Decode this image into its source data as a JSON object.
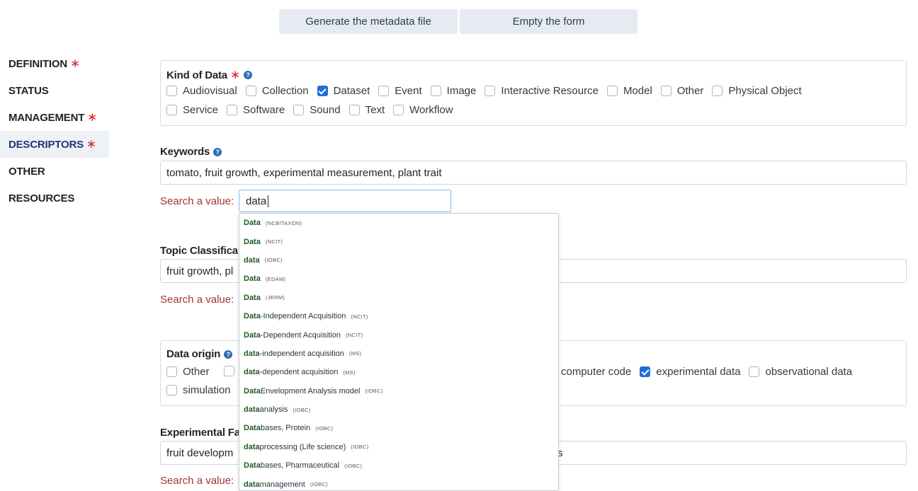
{
  "top_buttons": {
    "generate_label": "Generate the metadata file",
    "empty_label": "Empty the form"
  },
  "nav": {
    "items": [
      {
        "label": "DEFINITION",
        "required": true
      },
      {
        "label": "STATUS",
        "required": false
      },
      {
        "label": "MANAGEMENT",
        "required": true
      },
      {
        "label": "DESCRIPTORS",
        "required": true,
        "active": true
      },
      {
        "label": "OTHER",
        "required": false
      },
      {
        "label": "RESOURCES",
        "required": false
      }
    ],
    "required_mark": "∗"
  },
  "kind_of_data": {
    "label": "Kind of Data",
    "required_mark": "∗",
    "help_icon": "question-circle-icon",
    "row1": [
      {
        "label": "Audiovisual",
        "checked": false
      },
      {
        "label": "Collection",
        "checked": false
      },
      {
        "label": "Dataset",
        "checked": true
      },
      {
        "label": "Event",
        "checked": false
      },
      {
        "label": "Image",
        "checked": false
      },
      {
        "label": "Interactive Resource",
        "checked": false
      },
      {
        "label": "Model",
        "checked": false
      },
      {
        "label": "Other",
        "checked": false
      },
      {
        "label": "Physical Object",
        "checked": false
      }
    ],
    "row2": [
      {
        "label": "Service",
        "checked": false
      },
      {
        "label": "Software",
        "checked": false
      },
      {
        "label": "Sound",
        "checked": false
      },
      {
        "label": "Text",
        "checked": false
      },
      {
        "label": "Workflow",
        "checked": false
      }
    ]
  },
  "keywords": {
    "label": "Keywords",
    "value": "tomato, fruit growth, experimental measurement, plant trait",
    "search_label": "Search a value:",
    "search_value": "data"
  },
  "topic": {
    "label": "Topic Classifica",
    "value": "fruit growth, pl",
    "search_label": "Search a value:"
  },
  "data_origin": {
    "label": "Data origin",
    "row1_left": [
      {
        "label": "Other",
        "checked": false
      }
    ],
    "row1_right": [
      {
        "label": "computer code",
        "checked": false,
        "partial_box_hidden": true
      },
      {
        "label": "experimental data",
        "checked": true
      },
      {
        "label": "observational data",
        "checked": false
      }
    ],
    "row2": [
      {
        "label": "simulation",
        "checked": false
      }
    ]
  },
  "experimental": {
    "label": "Experimental Fa",
    "value": "fruit developm",
    "value_tail": "s",
    "search_label": "Search a value:"
  },
  "suggestions": [
    {
      "match": "Data",
      "rest": "",
      "source": "(NCBITAXON)"
    },
    {
      "match": "Data",
      "rest": "",
      "source": "(NCIT)"
    },
    {
      "match": "data",
      "rest": "",
      "source": "(IOBC)"
    },
    {
      "match": "Data",
      "rest": "",
      "source": "(EDAM)"
    },
    {
      "match": "Data",
      "rest": "",
      "source": "(JERM)"
    },
    {
      "match": "Data",
      "rest": "-Independent Acquisition",
      "source": "(NCIT)"
    },
    {
      "match": "Data",
      "rest": "-Dependent Acquisition",
      "source": "(NCIT)"
    },
    {
      "match": "data",
      "rest": "-independent acquisition",
      "source": "(MS)"
    },
    {
      "match": "data",
      "rest": "-dependent acquisition",
      "source": "(MS)"
    },
    {
      "match": "Data",
      "rest": " Envelopment Analysis model",
      "source": "(IOBC)"
    },
    {
      "match": "data",
      "rest": " analysis",
      "source": "(IOBC)"
    },
    {
      "match": "Data",
      "rest": "bases, Protein",
      "source": "(IOBC)"
    },
    {
      "match": "data",
      "rest": " processing (Life science)",
      "source": "(IOBC)"
    },
    {
      "match": "Data",
      "rest": "bases, Pharmaceutical",
      "source": "(IOBC)"
    },
    {
      "match": "data",
      "rest": " management",
      "source": "(IOBC)"
    }
  ]
}
